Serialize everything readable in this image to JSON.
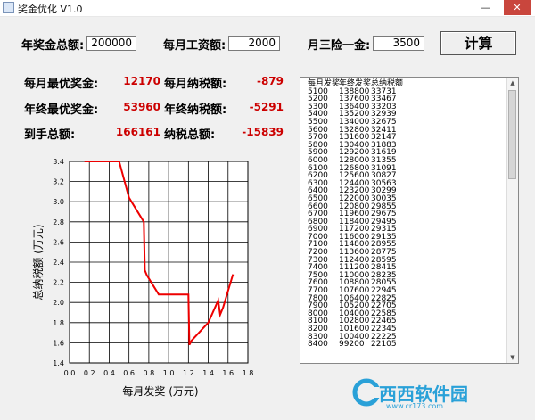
{
  "window": {
    "title": "奖金优化  V1.0",
    "minimize_glyph": "—",
    "close_glyph": "✕"
  },
  "inputs": {
    "annual_bonus_label": "年奖金总额:",
    "annual_bonus_value": "200000",
    "monthly_salary_label": "每月工资额:",
    "monthly_salary_value": "2000",
    "insurance_label": "月三险一金:",
    "insurance_value": "3500",
    "calc_button": "计算"
  },
  "results": {
    "monthly_bonus_label": "每月最优奖金:",
    "monthly_bonus_value": "12170",
    "monthly_tax_label": "每月纳税额:",
    "monthly_tax_value": "-879",
    "year_end_bonus_label": "年终最优奖金:",
    "year_end_bonus_value": "53960",
    "year_end_tax_label": "年终纳税额:",
    "year_end_tax_value": "-5291",
    "net_total_label": "到手总额:",
    "net_total_value": "166161",
    "tax_total_label": "纳税总额:",
    "tax_total_value": "-15839"
  },
  "list": {
    "headers": [
      "每月发奖",
      "年终发奖",
      "总纳税额"
    ],
    "rows": [
      [
        "5100",
        "138800",
        "33731"
      ],
      [
        "5200",
        "137600",
        "33467"
      ],
      [
        "5300",
        "136400",
        "33203"
      ],
      [
        "5400",
        "135200",
        "32939"
      ],
      [
        "5500",
        "134000",
        "32675"
      ],
      [
        "5600",
        "132800",
        "32411"
      ],
      [
        "5700",
        "131600",
        "32147"
      ],
      [
        "5800",
        "130400",
        "31883"
      ],
      [
        "5900",
        "129200",
        "31619"
      ],
      [
        "6000",
        "128000",
        "31355"
      ],
      [
        "6100",
        "126800",
        "31091"
      ],
      [
        "6200",
        "125600",
        "30827"
      ],
      [
        "6300",
        "124400",
        "30563"
      ],
      [
        "6400",
        "123200",
        "30299"
      ],
      [
        "6500",
        "122000",
        "30035"
      ],
      [
        "6600",
        "120800",
        "29855"
      ],
      [
        "6700",
        "119600",
        "29675"
      ],
      [
        "6800",
        "118400",
        "29495"
      ],
      [
        "6900",
        "117200",
        "29315"
      ],
      [
        "7000",
        "116000",
        "29135"
      ],
      [
        "7100",
        "114800",
        "28955"
      ],
      [
        "7200",
        "113600",
        "28775"
      ],
      [
        "7300",
        "112400",
        "28595"
      ],
      [
        "7400",
        "111200",
        "28415"
      ],
      [
        "7500",
        "110000",
        "28235"
      ],
      [
        "7600",
        "108800",
        "28055"
      ],
      [
        "7700",
        "107600",
        "22945"
      ],
      [
        "7800",
        "106400",
        "22825"
      ],
      [
        "7900",
        "105200",
        "22705"
      ],
      [
        "8000",
        "104000",
        "22585"
      ],
      [
        "8100",
        "102800",
        "22465"
      ],
      [
        "8200",
        "101600",
        "22345"
      ],
      [
        "8300",
        "100400",
        "22225"
      ],
      [
        "8400",
        "99200",
        "22105"
      ]
    ]
  },
  "chart_data": {
    "type": "line",
    "xlabel": "每月发奖 (万元)",
    "ylabel": "总纳税额 (万元)",
    "xlim": [
      0.0,
      1.8
    ],
    "ylim": [
      1.4,
      3.4
    ],
    "xticks": [
      "0.0",
      "0.2",
      "0.4",
      "0.6",
      "0.8",
      "1.0",
      "1.2",
      "1.4",
      "1.6",
      "1.8"
    ],
    "yticks": [
      "1.4",
      "1.6",
      "1.8",
      "2.0",
      "2.2",
      "2.4",
      "2.6",
      "2.8",
      "3.0",
      "3.2",
      "3.4"
    ],
    "grid": true,
    "line_color": "#ee0000",
    "series": [
      {
        "x": [
          0.15,
          0.5,
          0.6,
          0.75,
          0.76,
          0.78,
          0.9,
          0.95,
          1.2,
          1.21,
          1.22,
          1.23,
          1.4,
          1.5,
          1.52,
          1.55,
          1.65
        ],
        "y": [
          3.4,
          3.4,
          3.04,
          2.8,
          2.32,
          2.27,
          2.08,
          2.08,
          2.08,
          1.58,
          1.6,
          1.62,
          1.8,
          2.02,
          1.88,
          1.95,
          2.28
        ]
      }
    ]
  },
  "watermark": {
    "text": "西西软件园",
    "url": "www.cr173.com"
  }
}
